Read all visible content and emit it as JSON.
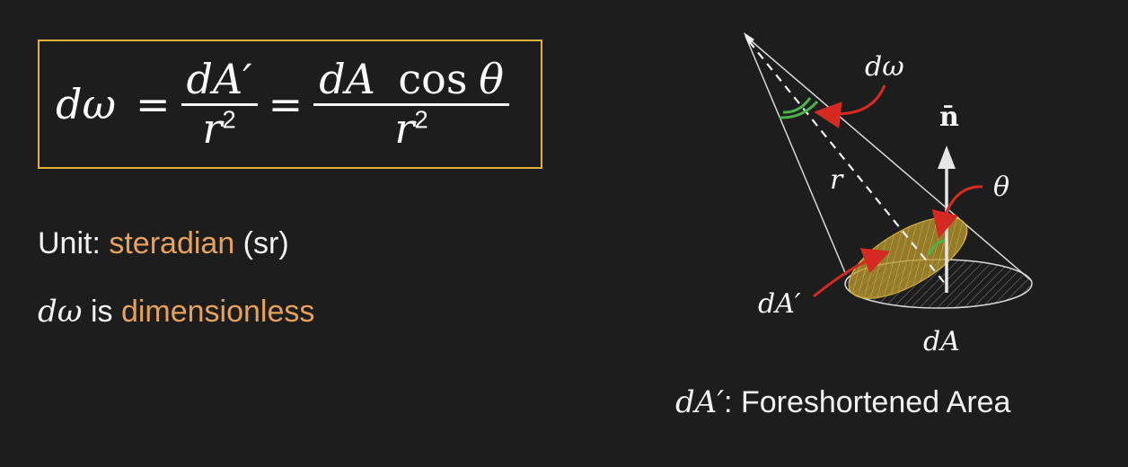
{
  "equation": {
    "lhs": "dω",
    "equals": "=",
    "frac1_num": "dA′",
    "frac1_den": "r",
    "frac1_den_exp": "2",
    "frac2_num_a": "dA",
    "frac2_num_b": "cos",
    "frac2_num_c": "θ",
    "frac2_den": "r",
    "frac2_den_exp": "2"
  },
  "unit_line": {
    "prefix": "Unit: ",
    "highlight": "steradian",
    "suffix": " (sr)"
  },
  "dimension_line": {
    "symbol": "dω",
    "middle": " is ",
    "highlight": "dimensionless"
  },
  "diagram": {
    "label_domega": "dω",
    "label_normal": "n̄",
    "label_theta": "θ",
    "label_r": "r",
    "label_dAprime": "dA′",
    "label_dA": "dA"
  },
  "caption": {
    "symbol": "dA′",
    "text": ": Foreshortened Area"
  },
  "colors": {
    "background": "#1d1d1d",
    "box_border": "#e2b23f",
    "accent_text": "#e6a25a",
    "arrow_red": "#d42a22",
    "arc_green": "#49b548",
    "foreshortened_fill": "#b8962b"
  }
}
